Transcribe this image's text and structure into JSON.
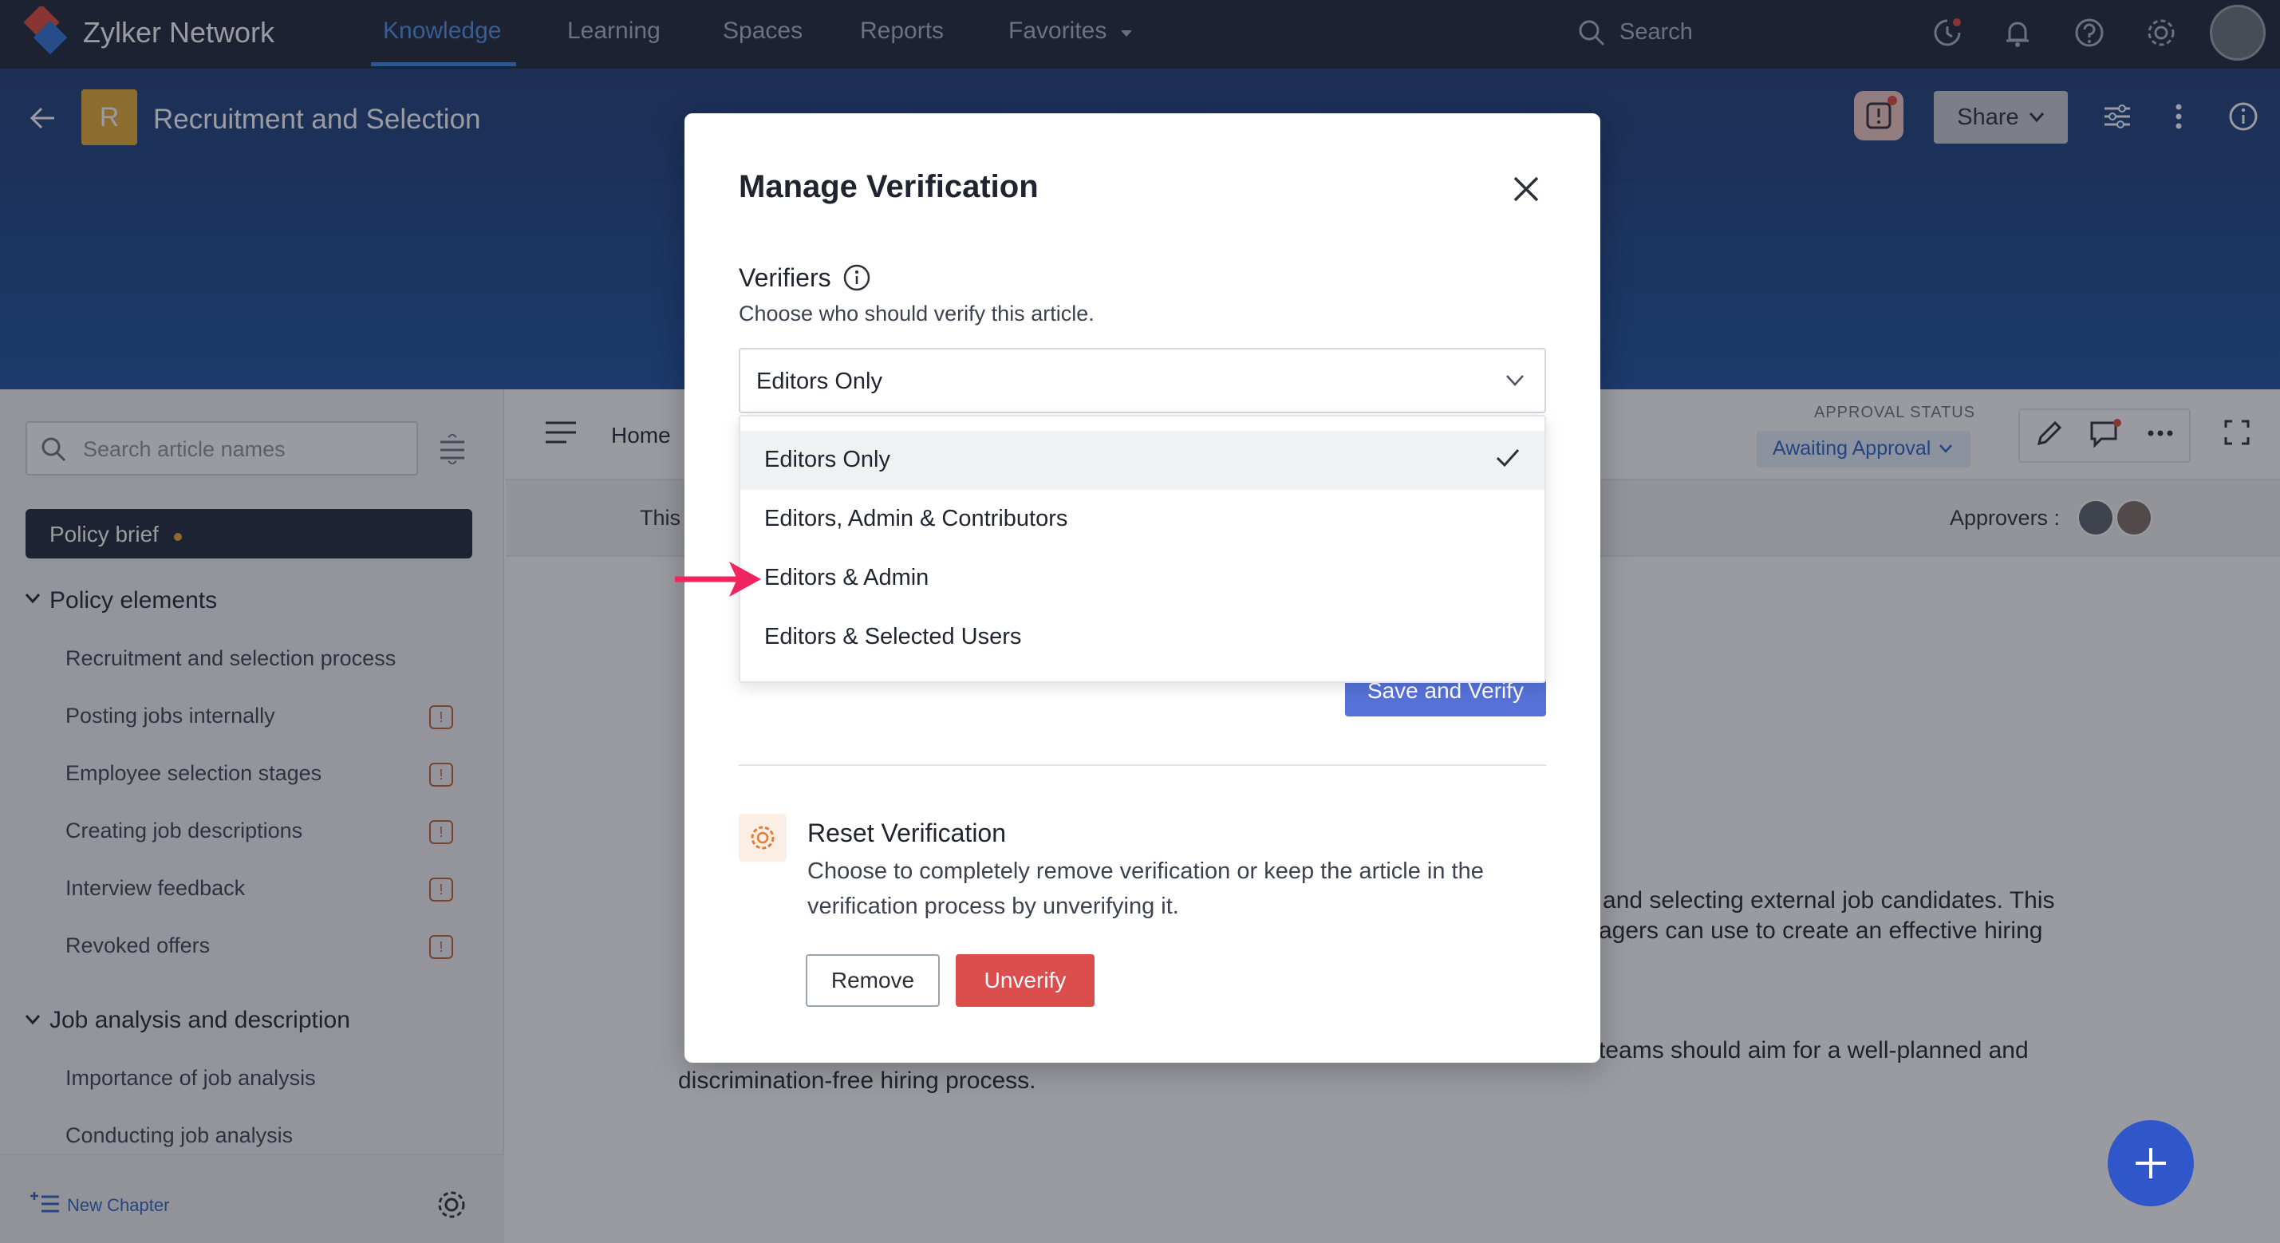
{
  "app": {
    "name": "Zylker Network"
  },
  "topnav": {
    "tabs": [
      {
        "label": "Knowledge"
      },
      {
        "label": "Learning"
      },
      {
        "label": "Spaces"
      },
      {
        "label": "Reports"
      },
      {
        "label": "Favorites"
      }
    ],
    "search_placeholder": "Search"
  },
  "header": {
    "badge": "R",
    "title": "Recruitment and Selection",
    "share_label": "Share"
  },
  "sidebar": {
    "search_placeholder": "Search article names",
    "active_item": "Policy brief",
    "sections": [
      {
        "title": "Policy elements",
        "items": [
          "Recruitment and selection process",
          "Posting jobs internally",
          "Employee selection stages",
          "Creating job descriptions",
          "Interview feedback",
          "Revoked offers"
        ]
      },
      {
        "title": "Job analysis and description",
        "items": [
          "Importance of job analysis",
          "Conducting job analysis"
        ]
      }
    ],
    "new_chapter_label": "New Chapter"
  },
  "content": {
    "breadcrumb": "Home",
    "approval_status_label": "APPROVAL STATUS",
    "approval_status_value": "Awaiting Approval",
    "info_prefix": "This",
    "approvers_label": "Approvers :",
    "body_line_1": "g and selecting external job candidates. This",
    "body_line_2": "agers can use to create an effective hiring",
    "body_line_3": "teams should aim for a well-planned and",
    "body_line_4": "discrimination-free hiring process."
  },
  "modal": {
    "title": "Manage Verification",
    "verifiers_title": "Verifiers",
    "verifiers_subtitle": "Choose who should verify this article.",
    "select_value": "Editors Only",
    "options": [
      "Editors Only",
      "Editors, Admin & Contributors",
      "Editors & Admin",
      "Editors & Selected Users"
    ],
    "save_label": "Save and Verify",
    "reset_title": "Reset Verification",
    "reset_description": "Choose to completely remove verification or keep the article in the verification process by unverifying it.",
    "remove_label": "Remove",
    "unverify_label": "Unverify"
  },
  "colors": {
    "accent": "#3b82e0",
    "danger": "#dc4e4e",
    "primary_button": "#5672d8",
    "annotation_arrow": "#f0245e"
  }
}
